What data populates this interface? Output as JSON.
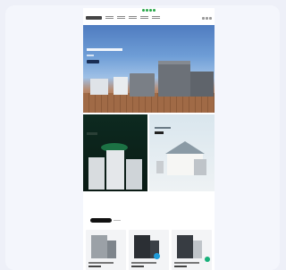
{
  "colors": {
    "accent_green": "#2aa84a",
    "hero_sky": "#6e9dd6",
    "dark_panel": "#0d2a20",
    "fab": "#18b07a"
  },
  "icons": [
    "logo-icon",
    "search-icon",
    "account-icon",
    "cart-icon",
    "chat-icon"
  ]
}
